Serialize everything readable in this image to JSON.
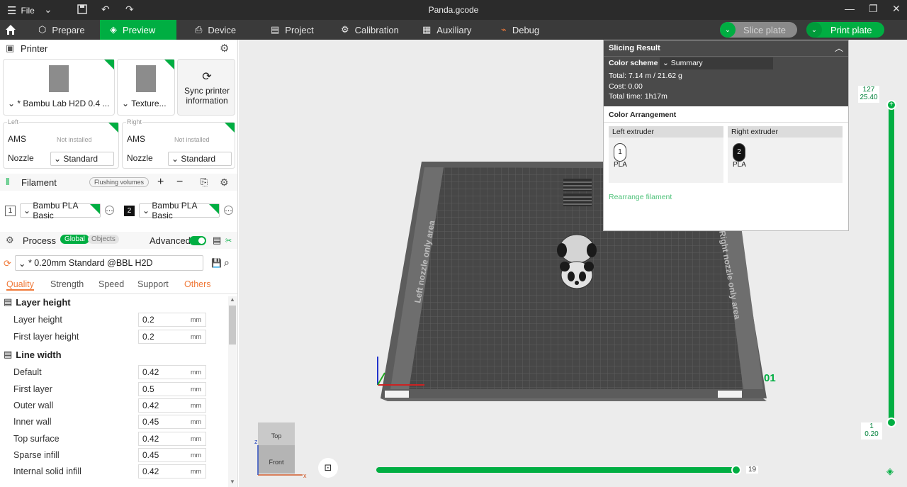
{
  "titlebar": {
    "file_label": "File",
    "title": "Panda.gcode"
  },
  "nav": {
    "tabs": [
      {
        "label": "Prepare"
      },
      {
        "label": "Preview"
      },
      {
        "label": "Device"
      },
      {
        "label": "Project"
      },
      {
        "label": "Calibration"
      },
      {
        "label": "Auxiliary"
      },
      {
        "label": "Debug"
      }
    ],
    "slice_label": "Slice plate",
    "print_label": "Print plate"
  },
  "printer": {
    "heading": "Printer",
    "name": "* Bambu Lab H2D 0.4 ...",
    "plate": "Texture...",
    "sync": "Sync printer information",
    "left": {
      "side": "Left",
      "ams": "AMS",
      "ams_status": "Not installed",
      "nozzle": "Nozzle",
      "nozzle_value": "Standard"
    },
    "right": {
      "side": "Right",
      "ams": "AMS",
      "ams_status": "Not installed",
      "nozzle": "Nozzle",
      "nozzle_value": "Standard"
    }
  },
  "filament": {
    "heading": "Filament",
    "flushing": "Flushing volumes",
    "items": [
      {
        "index": "1",
        "name": "Bambu PLA Basic"
      },
      {
        "index": "2",
        "name": "Bambu PLA Basic"
      }
    ]
  },
  "process": {
    "heading": "Process",
    "global": "Global",
    "objects": "Objects",
    "advanced": "Advanced",
    "preset": "* 0.20mm Standard @BBL H2D",
    "tabs": [
      "Quality",
      "Strength",
      "Speed",
      "Support",
      "Others"
    ],
    "groups": [
      {
        "title": "Layer height",
        "rows": [
          {
            "label": "Layer height",
            "value": "0.2",
            "unit": "mm"
          },
          {
            "label": "First layer height",
            "value": "0.2",
            "unit": "mm"
          }
        ]
      },
      {
        "title": "Line width",
        "rows": [
          {
            "label": "Default",
            "value": "0.42",
            "unit": "mm"
          },
          {
            "label": "First layer",
            "value": "0.5",
            "unit": "mm"
          },
          {
            "label": "Outer wall",
            "value": "0.42",
            "unit": "mm"
          },
          {
            "label": "Inner wall",
            "value": "0.45",
            "unit": "mm"
          },
          {
            "label": "Top surface",
            "value": "0.42",
            "unit": "mm"
          },
          {
            "label": "Sparse infill",
            "value": "0.45",
            "unit": "mm"
          },
          {
            "label": "Internal solid infill",
            "value": "0.42",
            "unit": "mm"
          }
        ]
      }
    ]
  },
  "slicing": {
    "title": "Slicing Result",
    "color_scheme_label": "Color scheme",
    "color_scheme_value": "Summary",
    "total": "Total:  7.14 m / 21.62 g",
    "cost": "Cost:  0.00",
    "total_time": "Total time:  1h17m",
    "arrangement": "Color Arrangement",
    "left_extruder": "Left extruder",
    "right_extruder": "Right extruder",
    "left_slot": "1",
    "right_slot": "2",
    "material": "PLA",
    "rearrange": "Rearrange filament"
  },
  "viewport": {
    "bed_left_label": "Left nozzle only area",
    "bed_right_label": "Right nozzle only area",
    "plate_number": "01",
    "cube_top": "Top",
    "cube_front": "Front",
    "axis_z": "z",
    "axis_x": "x",
    "layer_top": "127",
    "layer_top_height": "25.40",
    "layer_bottom": "1",
    "layer_bottom_height": "0.20",
    "move_value": "19",
    "move_progress": 1.0
  }
}
